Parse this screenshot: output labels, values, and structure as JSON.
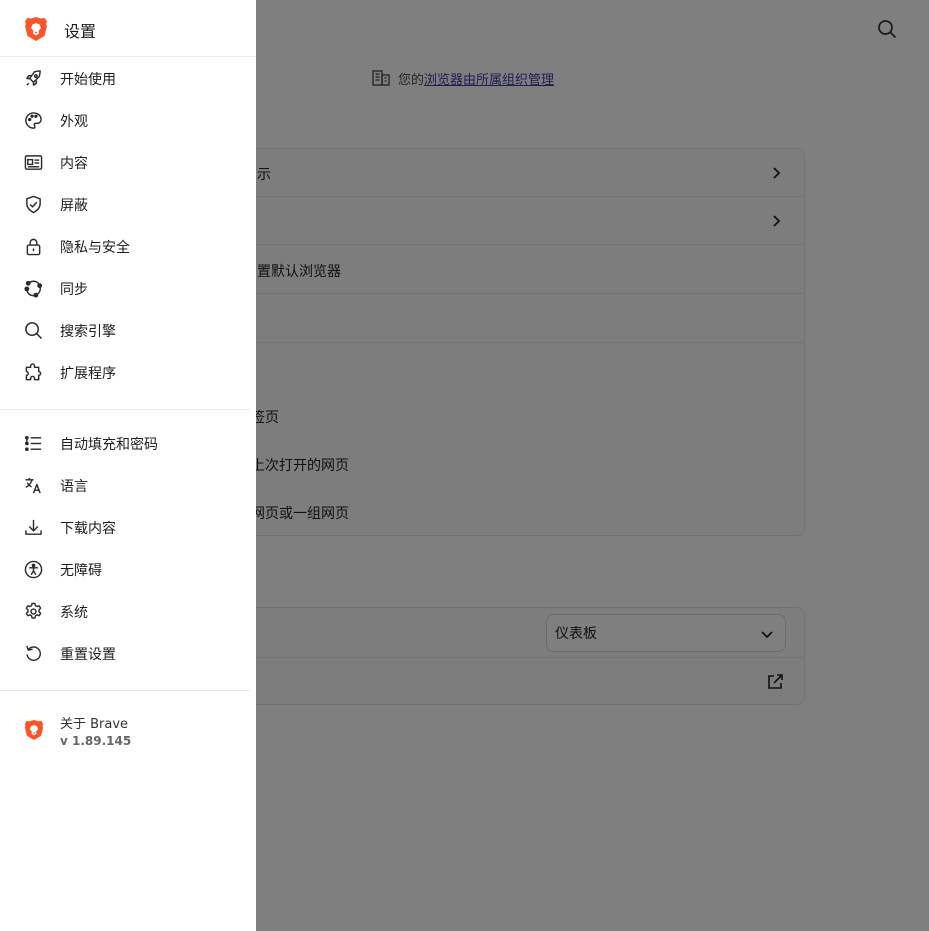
{
  "drawer": {
    "title": "设置",
    "items_group1": [
      {
        "label": "开始使用",
        "icon": "rocket-icon"
      },
      {
        "label": "外观",
        "icon": "palette-icon"
      },
      {
        "label": "内容",
        "icon": "content-icon"
      },
      {
        "label": "屏蔽",
        "icon": "shield-icon"
      },
      {
        "label": "隐私与安全",
        "icon": "lock-icon"
      },
      {
        "label": "同步",
        "icon": "sync-icon"
      },
      {
        "label": "搜索引擎",
        "icon": "search-icon"
      },
      {
        "label": "扩展程序",
        "icon": "puzzle-icon"
      }
    ],
    "items_group2": [
      {
        "label": "自动填充和密码",
        "icon": "list-icon"
      },
      {
        "label": "语言",
        "icon": "translate-icon"
      },
      {
        "label": "下载内容",
        "icon": "download-icon"
      },
      {
        "label": "无障碍",
        "icon": "accessibility-icon"
      },
      {
        "label": "系统",
        "icon": "gear-icon"
      },
      {
        "label": "重置设置",
        "icon": "reset-icon"
      }
    ],
    "about": {
      "label": "关于 Brave",
      "version": "v 1.89.145"
    }
  },
  "background": {
    "managed_prefix": "您的",
    "managed_link": "浏览器由所属组织管理",
    "rows": {
      "row1_text": "示",
      "row3_text": "置默认浏览器",
      "radio1": "签页",
      "radio2": "上次打开的网页",
      "radio3": "网页或一组网页"
    },
    "select_value": "仪表板"
  },
  "colors": {
    "brand_orange": "#fb542b",
    "link": "#3d3aa8",
    "overlay": "rgba(0,0,0,0.5)"
  }
}
